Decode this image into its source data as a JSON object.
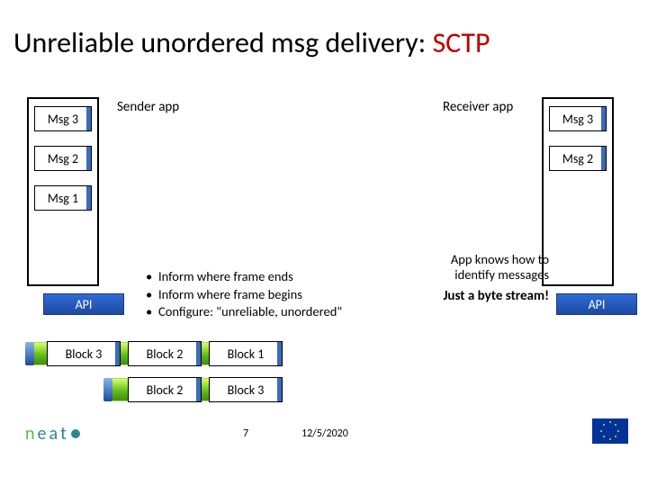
{
  "title": {
    "prefix": "Unreliable unordered msg delivery: ",
    "accent": "SCTP"
  },
  "sender_app": "Sender app",
  "receiver_app": "Receiver app",
  "left_msgs": [
    "Msg 3",
    "Msg 2",
    "Msg 1"
  ],
  "right_msgs": [
    "Msg 3",
    "Msg 2"
  ],
  "api_label": "API",
  "bullets": [
    "Inform where frame ends",
    "Inform where frame begins",
    "Configure: \"unreliable, unordered\""
  ],
  "app_knows": "App knows how to identify messages",
  "just_byte": "Just a byte stream!",
  "blocks_row1": [
    "Block 3",
    "Block 2",
    "Block 1"
  ],
  "blocks_row2": [
    "Block 2",
    "Block 3"
  ],
  "page": "7",
  "date": "12/5/2020",
  "logo_text": "neat",
  "colors": {
    "accent_red": "#c00000",
    "api_blue": "#1e4aa0",
    "stripe": "#3a6bbd",
    "eu_bg": "#003399",
    "eu_gold": "#ffcc00"
  }
}
